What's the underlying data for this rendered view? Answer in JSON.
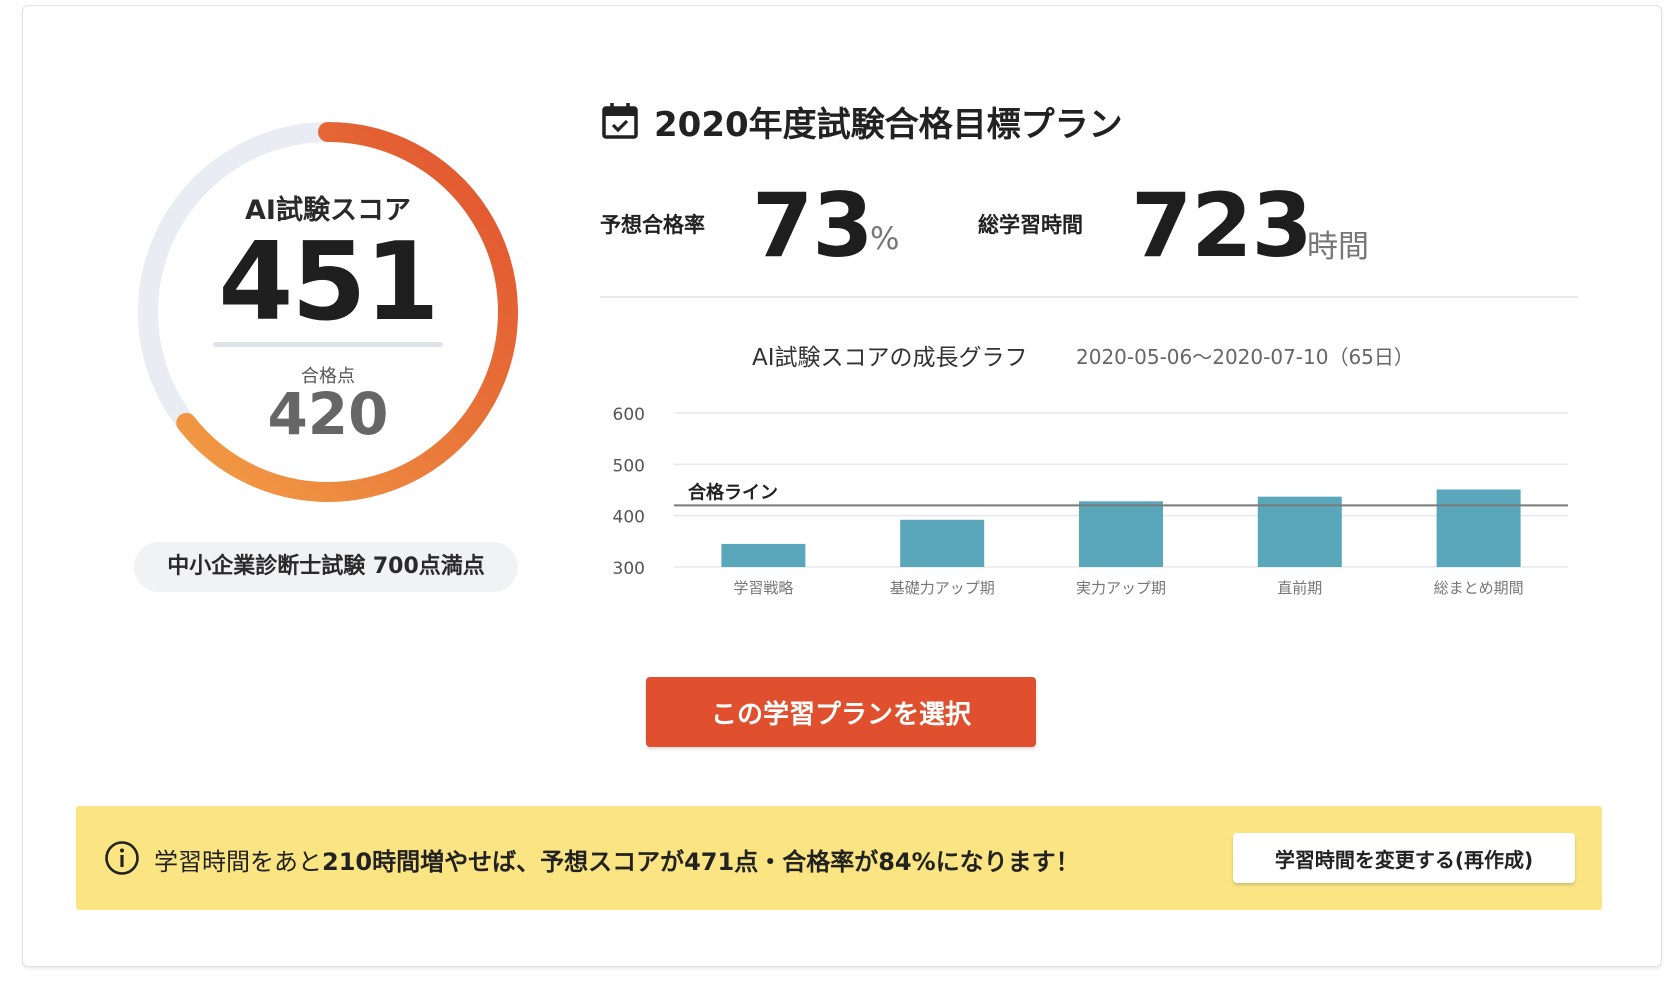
{
  "gauge": {
    "title": "AI試験スコア",
    "score": "451",
    "pass_label": "合格点",
    "pass_score": "420",
    "score_value": 451,
    "max_value": 700,
    "colors": {
      "track": "#e9edf3",
      "start": "#f29d45",
      "end": "#e0502e"
    }
  },
  "exam_badge": "中小企業診断士試験 700点満点",
  "plan": {
    "title": "2020年度試験合格目標プラン",
    "icon": "calendar-check-icon",
    "pass_rate_label": "予想合格率",
    "pass_rate_value": "73",
    "pass_rate_unit": "%",
    "study_time_label": "総学習時間",
    "study_time_value": "723",
    "study_time_unit": "時間"
  },
  "chart_data": {
    "type": "bar",
    "title": "AI試験スコアの成長グラフ",
    "date_range": "2020-05-06〜2020-07-10（65日）",
    "categories": [
      "学習戦略",
      "基礎力アップ期",
      "実力アップ期",
      "直前期",
      "総まとめ期間"
    ],
    "values": [
      345,
      392,
      428,
      437,
      451
    ],
    "ylim": [
      300,
      600
    ],
    "yticks": [
      300,
      400,
      500,
      600
    ],
    "reference_line": {
      "label": "合格ライン",
      "value": 420
    },
    "grid": true,
    "bar_color": "#5aa6bb"
  },
  "cta_label": "この学習プランを選択",
  "notice": {
    "icon": "info-circle-icon",
    "text_prefix": "学習時間をあと",
    "text_bold": "210時間増やせば、予想スコアが471点・合格率が84%になります！",
    "button_label": "学習時間を変更する(再作成)"
  }
}
